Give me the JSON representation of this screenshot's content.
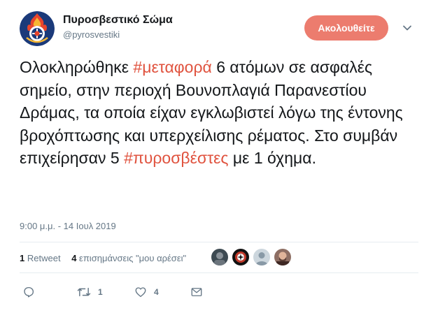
{
  "header": {
    "name": "Πυροσβεστικό Σώμα",
    "handle": "@pyrosvestiki",
    "follow_label": "Ακολουθείτε"
  },
  "tweet": {
    "segments": [
      {
        "text": "Ολοκληρώθηκε ",
        "hashtag": false
      },
      {
        "text": "#μεταφορά",
        "hashtag": true
      },
      {
        "text": " 6 ατόμων σε ασφαλές σημείο, στην περιοχή Βουνοπλαγιά Παρανεστίου Δράμας, τα οποία είχαν εγκλωβιστεί λόγω της έντονης βροχόπτωσης και υπερχείλισης ρέματος. Στο συμβάν επιχείρησαν 5 ",
        "hashtag": false
      },
      {
        "text": "#πυροσβέστες",
        "hashtag": true
      },
      {
        "text": " με 1 όχημα.",
        "hashtag": false
      }
    ],
    "timestamp": "9:00 μ.μ. - 14 Ιουλ 2019"
  },
  "stats": {
    "retweets_count": "1",
    "retweets_label": "Retweet",
    "likes_count": "4",
    "likes_label": "επισημάνσεις \"μου αρέσει\""
  },
  "actions": {
    "reply_count": "",
    "retweet_count": "1",
    "like_count": "4"
  },
  "colors": {
    "accent": "#e0533f",
    "follow_bg": "#ec7c6e",
    "secondary_text": "#657786"
  },
  "icons": {
    "reply": "reply-icon",
    "retweet": "retweet-icon",
    "like": "heart-icon",
    "dm": "envelope-icon",
    "menu": "chevron-down-icon"
  }
}
